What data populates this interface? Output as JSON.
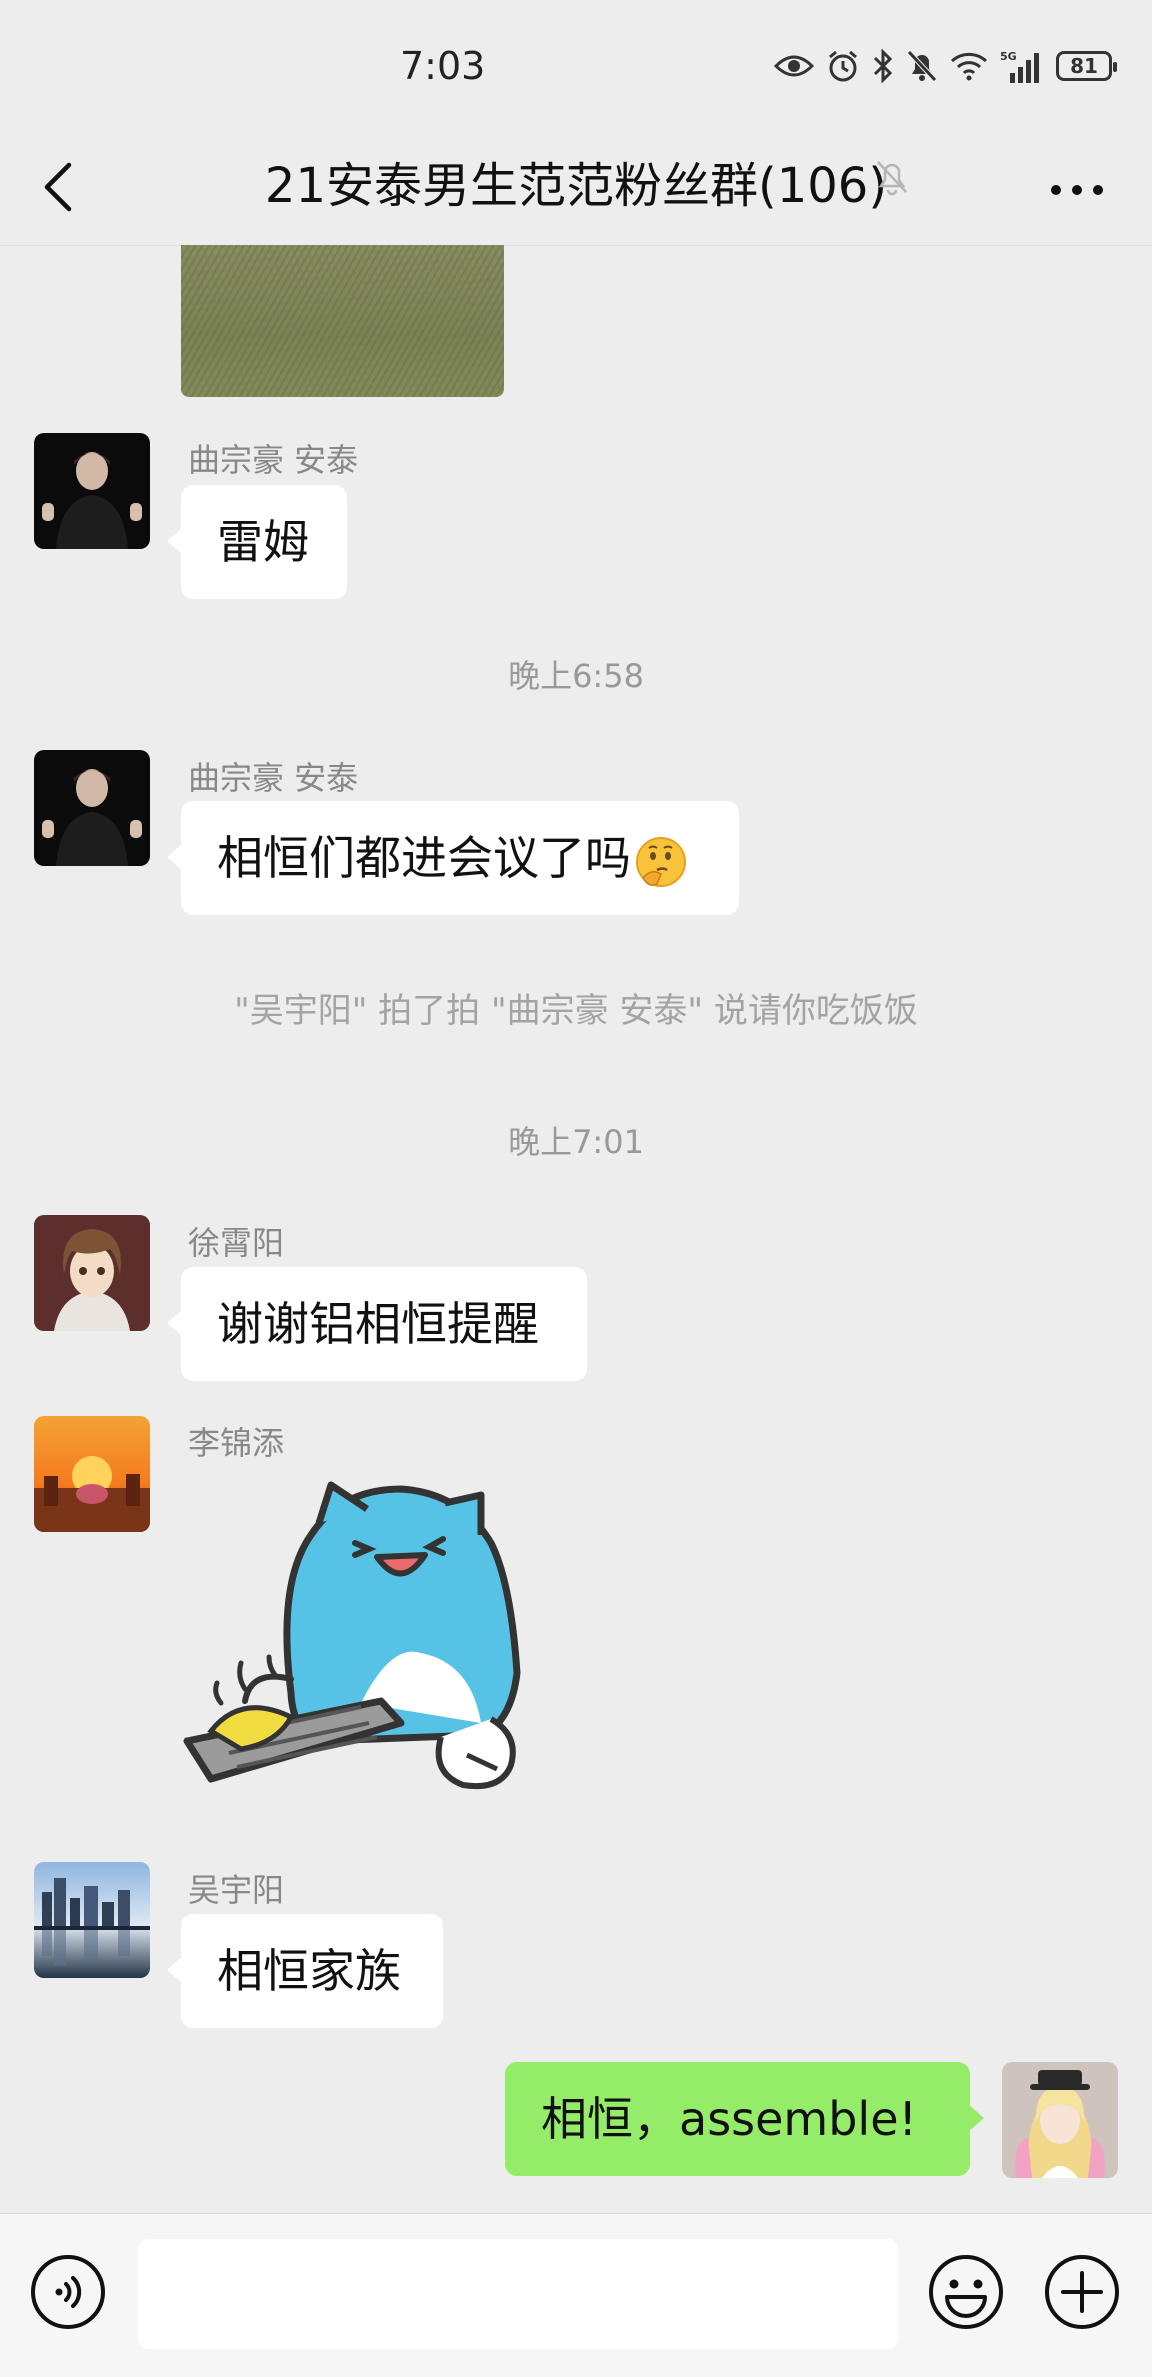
{
  "status_bar": {
    "time": "7:03",
    "network": "5G",
    "battery": "81"
  },
  "header": {
    "title": "21安泰男生范范粉丝群(106)",
    "back_icon": "chevron-left-icon",
    "mute_icon": "bell-off-icon",
    "more_icon": "more-dots-icon"
  },
  "messages": {
    "m1": {
      "sender": "曲宗豪 安泰",
      "text": "雷姆"
    },
    "t1": "晚上6:58",
    "m2": {
      "sender": "曲宗豪 安泰",
      "text": "相恒们都进会议了吗"
    },
    "pat": "\"吴宇阳\" 拍了拍 \"曲宗豪 安泰\" 说请你吃饭饭",
    "t2": "晚上7:01",
    "m3": {
      "sender": "徐霄阳",
      "text": "谢谢铝相恒提醒"
    },
    "m4": {
      "sender": "李锦添",
      "sticker": "blue-cat-keyboard-sticker"
    },
    "m5": {
      "sender": "吴宇阳",
      "text": "相恒家族"
    },
    "m6": {
      "text": "相恒，assemble!"
    }
  },
  "input_bar": {
    "placeholder": "",
    "voice_icon": "voice-icon",
    "emoji_icon": "emoji-icon",
    "plus_icon": "plus-icon"
  },
  "colors": {
    "background": "#ededed",
    "my_bubble": "#95ec69",
    "other_bubble": "#ffffff",
    "meta_text": "#999999"
  }
}
